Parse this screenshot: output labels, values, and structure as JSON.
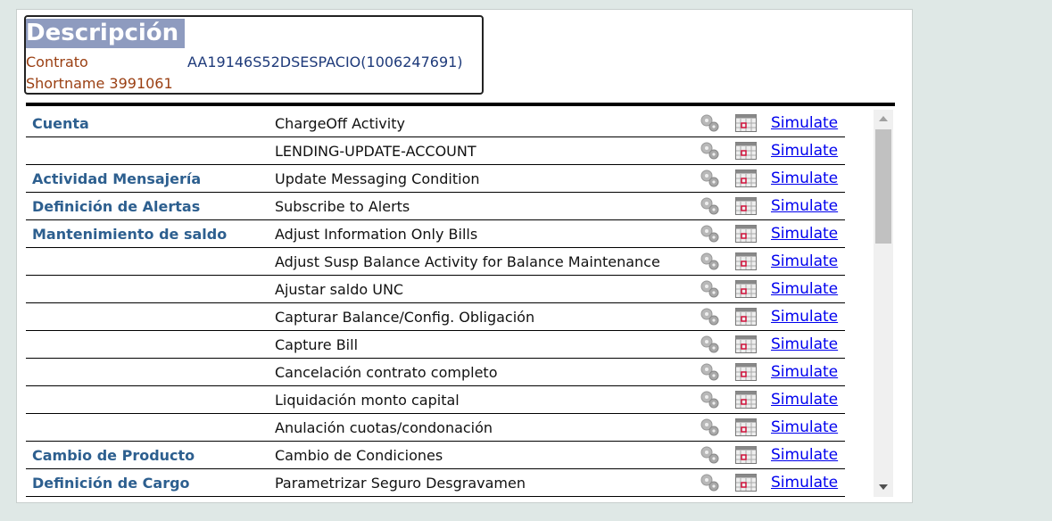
{
  "header": {
    "title": "Descripción",
    "contrato_label": "Contrato",
    "contrato_value": "AA19146S52DSESPACIO(1006247691)",
    "shortname": "Shortname 3991061"
  },
  "colors": {
    "category": "#2d5f8f",
    "label": "#9a3f12",
    "value": "#1e3a7a",
    "link": "#0000ee"
  },
  "rows": [
    {
      "category": "Cuenta",
      "activity": "ChargeOff Activity",
      "link": "Simulate"
    },
    {
      "category": "",
      "activity": "LENDING-UPDATE-ACCOUNT",
      "link": "Simulate"
    },
    {
      "category": "Actividad Mensajería",
      "activity": "Update Messaging Condition",
      "link": "Simulate"
    },
    {
      "category": "Definición de Alertas",
      "activity": "Subscribe to Alerts",
      "link": "Simulate"
    },
    {
      "category": "Mantenimiento de saldo",
      "activity": "Adjust Information Only Bills",
      "link": "Simulate"
    },
    {
      "category": "",
      "activity": "Adjust Susp Balance Activity for Balance Maintenance",
      "link": "Simulate"
    },
    {
      "category": "",
      "activity": "Ajustar saldo UNC",
      "link": "Simulate"
    },
    {
      "category": "",
      "activity": "Capturar Balance/Config. Obligación",
      "link": "Simulate"
    },
    {
      "category": "",
      "activity": "Capture Bill",
      "link": "Simulate"
    },
    {
      "category": "",
      "activity": "Cancelación contrato completo",
      "link": "Simulate"
    },
    {
      "category": "",
      "activity": "Liquidación monto capital",
      "link": "Simulate"
    },
    {
      "category": "",
      "activity": "Anulación cuotas/condonación",
      "link": "Simulate"
    },
    {
      "category": "Cambio de Producto",
      "activity": "Cambio de Condiciones",
      "link": "Simulate"
    },
    {
      "category": "Definición de Cargo",
      "activity": "Parametrizar Seguro Desgravamen",
      "link": "Simulate"
    }
  ],
  "row_icons": [
    "gears-icon",
    "calendar-icon"
  ]
}
